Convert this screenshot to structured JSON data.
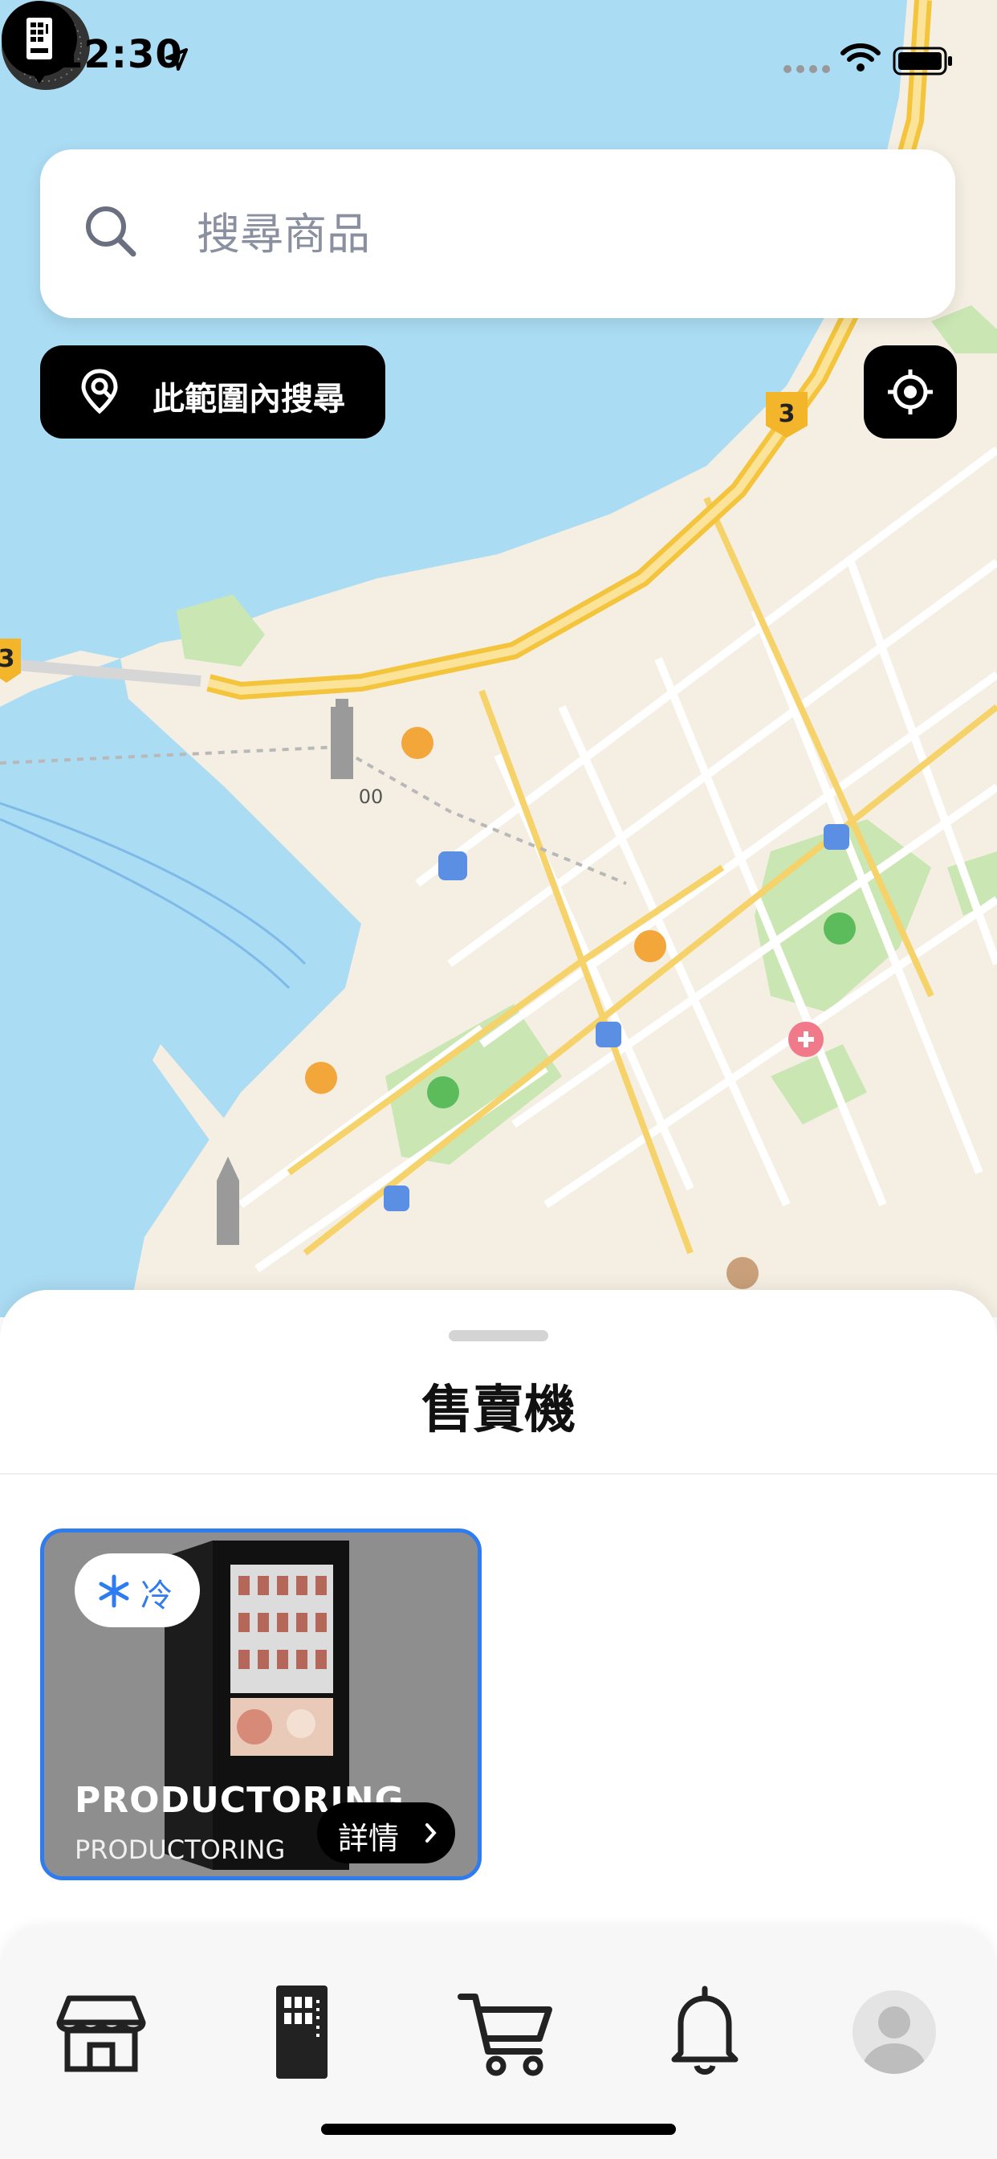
{
  "status_bar": {
    "time": "12:30"
  },
  "search": {
    "placeholder": "搜尋商品"
  },
  "map_controls": {
    "search_area_label": "此範圍內搜尋"
  },
  "map": {
    "road_shield": "3",
    "road_shield_left": "3",
    "building_label": "00"
  },
  "sheet": {
    "title": "售賣機",
    "machines": [
      {
        "temperature_label": "冷",
        "name": "PRODUCTORING",
        "subtitle": "PRODUCTORING",
        "details_label": "詳情"
      }
    ]
  },
  "tabs": [
    {
      "icon": "store-icon"
    },
    {
      "icon": "vending-machine-icon"
    },
    {
      "icon": "cart-icon"
    },
    {
      "icon": "bell-icon"
    },
    {
      "icon": "avatar-icon"
    }
  ],
  "colors": {
    "accent": "#2f7bf0",
    "water": "#aadcf3",
    "land": "#f5efe3",
    "road": "#f7cf4a"
  }
}
